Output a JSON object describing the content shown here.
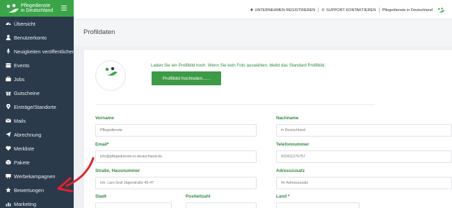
{
  "brand": {
    "line1": "Pflegedienste",
    "line2": "in Deutschland"
  },
  "sidebar": {
    "items": [
      {
        "label": "Übersicht",
        "icon": "dashboard-icon"
      },
      {
        "label": "Benutzerkonto",
        "icon": "user-icon"
      },
      {
        "label": "Neuigkeiten veröffentlichen",
        "icon": "microphone-icon"
      },
      {
        "label": "Events",
        "icon": "calendar-icon"
      },
      {
        "label": "Jobs",
        "icon": "briefcase-icon"
      },
      {
        "label": "Gutscheine",
        "icon": "gift-icon"
      },
      {
        "label": "Einträge/Standorte",
        "icon": "map-marker-icon"
      },
      {
        "label": "Mails",
        "icon": "envelope-icon"
      },
      {
        "label": "Abrechnung",
        "icon": "paper-plane-icon"
      },
      {
        "label": "Merkliste",
        "icon": "heart-icon"
      },
      {
        "label": "Pakete",
        "icon": "box-icon"
      },
      {
        "label": "Werbekampagnen",
        "icon": "billboard-icon"
      },
      {
        "label": "Bewertungen",
        "icon": "star-icon"
      },
      {
        "label": "Marketing",
        "icon": "chart-icon"
      }
    ]
  },
  "topbar": {
    "register": "UNTERNEHMEN REGISTRIEREN",
    "contact": "SUPPORT KONTAKTIEREN",
    "account": "Pflegedienste in Deutschland"
  },
  "page": {
    "title": "Profildaten"
  },
  "profile": {
    "upload_hint": "Laden Sie ein Profilbild hoch. Wenn Sie kein Foto auswählen, bleibt das Standard Profilbild.",
    "upload_button": "Profilbild hochloden......"
  },
  "form": {
    "vorname": {
      "label": "Vorname",
      "value": "Pflegedienste"
    },
    "nachname": {
      "label": "Nachname",
      "value": "in Deutschland"
    },
    "email": {
      "label": "Email*",
      "value": "info@pflegedienste-in-deutschland.de"
    },
    "telefon": {
      "label": "Telefonnummer",
      "value": "022411276757"
    },
    "strasse": {
      "label": "Straße, Hausnummer",
      "value": "Inh. Lars Graf Jägerstraße 45-47"
    },
    "adresszusatz": {
      "label": "Adresszusatz",
      "placeholder": "Ihr Adresszusatz"
    },
    "stadt": {
      "label": "Stadt"
    },
    "plz": {
      "label": "Postleitzahl"
    },
    "land": {
      "label": "Land *"
    }
  },
  "colors": {
    "sidebar": "#2b3a4a",
    "brand": "#3aa548",
    "accent": "#2e8b3e",
    "arrow": "#e8202a"
  }
}
